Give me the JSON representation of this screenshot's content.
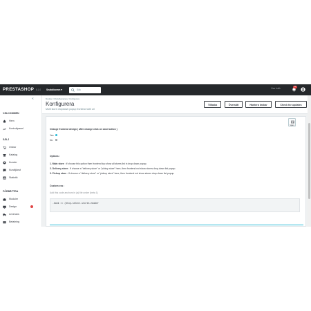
{
  "topbar": {
    "logo": "PRESTASHOP",
    "version": "8.1.0",
    "quick_access": "Snabbkomm ▾",
    "search_placeholder": "Sök",
    "right_text": "Visa butik",
    "notification_count": "12"
  },
  "sidebar": {
    "sections": [
      {
        "title": "VÄLKOMMEN",
        "items": [
          {
            "label": "Hem",
            "icon": "home-icon"
          },
          {
            "label": "Kontrollpanel",
            "icon": "trending-up-icon"
          }
        ]
      },
      {
        "title": "SÄLJ",
        "items": [
          {
            "label": "Ordrar",
            "icon": "cart-icon"
          },
          {
            "label": "Katalog",
            "icon": "store-icon"
          },
          {
            "label": "Kunder",
            "icon": "user-icon"
          },
          {
            "label": "Kundtjänst",
            "icon": "chat-icon"
          },
          {
            "label": "Statistik",
            "icon": "chart-icon"
          }
        ]
      },
      {
        "title": "FÖRBÄTTRA",
        "items": [
          {
            "label": "Moduler",
            "icon": "puzzle-icon"
          },
          {
            "label": "Design",
            "icon": "monitor-icon"
          },
          {
            "label": "Leverans",
            "icon": "truck-icon"
          },
          {
            "label": "Betalning",
            "icon": "card-icon"
          }
        ]
      }
    ]
  },
  "header": {
    "breadcrumb": "Moduler  /  Modulhanterare  /  Konfigurera",
    "title": "Konfigurera",
    "subtitle": "Multi store dropdown popup frontend with url",
    "buttons": [
      "Tillbaka",
      "Översätt",
      "Hantera krokar",
      "Check for updates"
    ]
  },
  "panel": {
    "save_label": "Spara",
    "change_frontend_label": "Change frontend design ( after change click on save button )",
    "yes_label": "Yes",
    "no_label": "No",
    "options_label": "Options :",
    "option1_num": "1.",
    "option1_name": "Main store",
    "option1_text": ": If choose this option then frontend top show all stores list in drop down popup.",
    "option2_num": "2.",
    "option2_name": "Delivery store",
    "option2_text": ": If choose a \"delivery store\" or \"pickup store\" here, then frontend not show stores drop-down list popup.",
    "option3_num": "3.",
    "option3_name": "Pickup store",
    "option3_text": ": If choose a \"delivery store\" or \"pickup store\" here, then frontend not show stores drop-down list popup.",
    "custom_css_label": "Custom css :",
    "custom_css_help": "Add this code anchors in (a) file under (beta 1)",
    "custom_css_value": ".bank >= (#top-select-stores-header"
  },
  "colors": {
    "topbar": "#25282b",
    "accent": "#25b9d7",
    "badge": "#e04444"
  }
}
